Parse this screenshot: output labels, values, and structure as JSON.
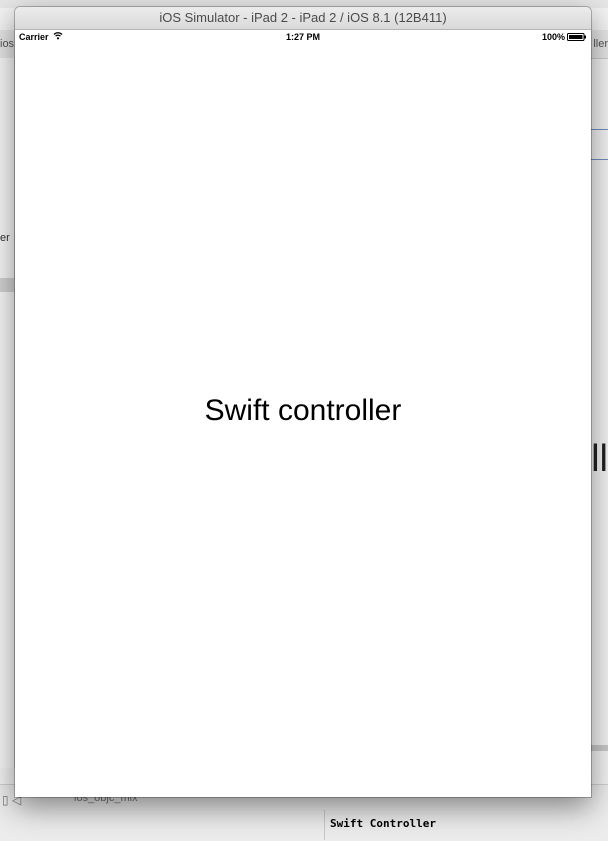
{
  "background": {
    "left_tab": "ios",
    "right_tab": "ller",
    "left_panel_text": "er",
    "right_big_text": "ll",
    "bottom_file_label": "ios_objc_mix",
    "console_text": "Swift Controller"
  },
  "simulator": {
    "title": "iOS Simulator - iPad 2 - iPad 2 / iOS 8.1 (12B411)",
    "status_bar": {
      "carrier": "Carrier",
      "time": "1:27 PM",
      "battery": "100%",
      "wifi_icon": "wifi-icon",
      "battery_icon": "battery-icon"
    },
    "content": {
      "label": "Swift controller"
    }
  }
}
